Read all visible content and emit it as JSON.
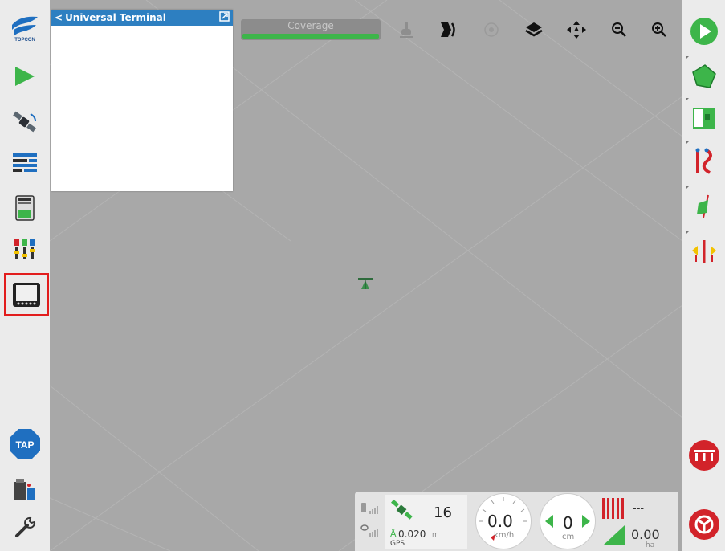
{
  "ut_panel": {
    "title": "Universal Terminal",
    "back_glyph": "<"
  },
  "toolbar": {
    "coverage_label": "Coverage",
    "coverage_progress": 1.0
  },
  "left_bar": {
    "tap_label": "TAP",
    "active_item": "universal-terminal"
  },
  "status": {
    "satellites": "16",
    "accuracy_value": "0.020",
    "accuracy_unit": "m",
    "position_source": "GPS",
    "speed_value": "0.0",
    "speed_unit": "km/h",
    "offset_value": "0",
    "offset_unit": "cm",
    "count_value": "---",
    "area_value": "0.00",
    "area_unit": "ha"
  },
  "colors": {
    "accent_blue": "#2d7fc1",
    "green": "#3db54a",
    "red": "#d2232a",
    "active_outline": "#e21d1d"
  }
}
